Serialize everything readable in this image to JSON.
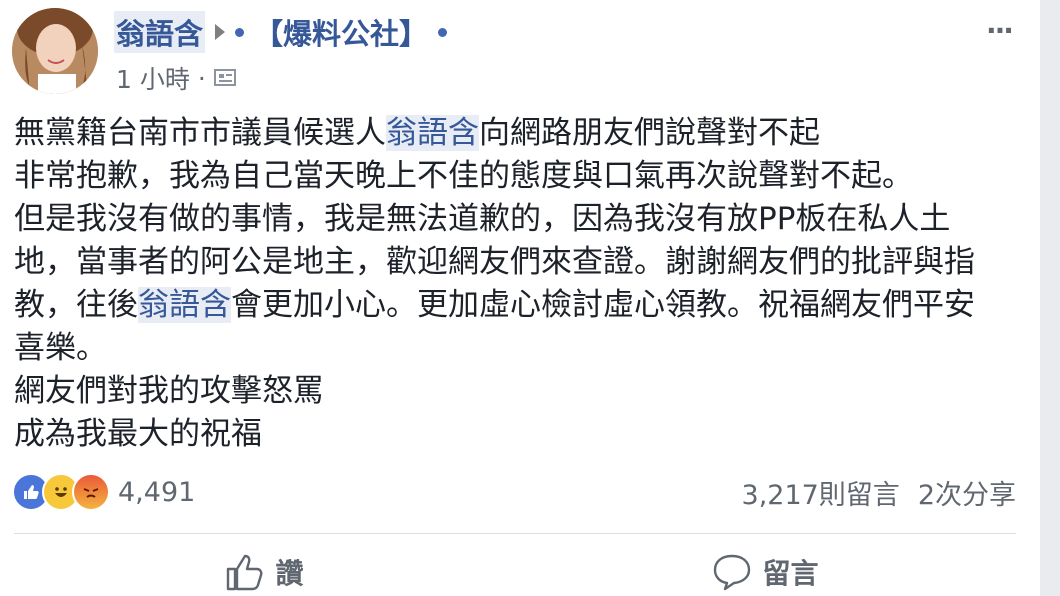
{
  "post": {
    "author": "翁語含",
    "page": "【爆料公社】",
    "time": "1 小時",
    "meta_separator": "·",
    "more": "···",
    "body": [
      [
        {
          "t": "無黨籍台南市市議員候選人"
        },
        {
          "t": "翁語含",
          "m": true
        },
        {
          "t": "向網路朋友們說聲對不起"
        }
      ],
      [
        {
          "t": "非常抱歉，我為自己當天晚上不佳的態度與口氣再次說聲對不起。"
        }
      ],
      [
        {
          "t": "但是我沒有做的事情，我是無法道歉的，因為我沒有放PP板在私人土"
        }
      ],
      [
        {
          "t": "地，當事者的阿公是地主，歡迎網友們來查證。謝謝網友們的批評與指"
        }
      ],
      [
        {
          "t": "教，往後"
        },
        {
          "t": "翁語含",
          "m": true
        },
        {
          "t": "會更加小心。更加虛心檢討虛心領教。祝福網友們平安"
        }
      ],
      [
        {
          "t": "喜樂。"
        }
      ],
      [
        {
          "t": "網友們對我的攻擊怒罵"
        }
      ],
      [
        {
          "t": "成為我最大的祝福"
        }
      ]
    ]
  },
  "stats": {
    "reactions": [
      "like-icon",
      "haha-icon",
      "angry-icon"
    ],
    "reaction_count": "4,491",
    "comments": "3,217則留言",
    "shares": "2次分享"
  },
  "actions": {
    "like_label": "讚",
    "comment_label": "留言"
  },
  "colors": {
    "link": "#365899",
    "mention_bg": "#e8ecf4",
    "muted": "#606770"
  }
}
